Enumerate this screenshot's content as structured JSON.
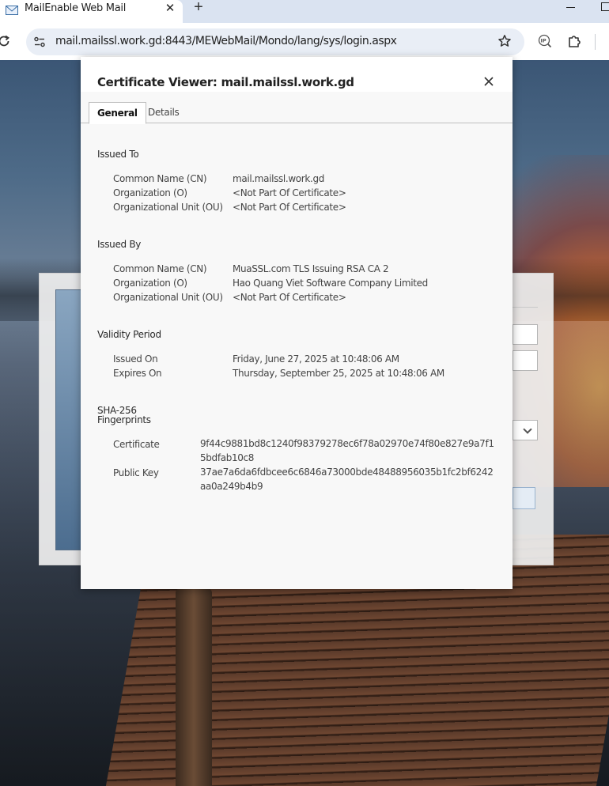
{
  "browser": {
    "tab_title": "MailEnable Web Mail",
    "tab_close": "✕",
    "new_tab": "+",
    "url": "mail.mailssl.work.gd:8443/MEWebMail/Mondo/lang/sys/login.aspx",
    "icons": [
      "envelope-favicon",
      "reload-icon",
      "site-info-icon",
      "star-icon",
      "ip-extension-icon",
      "extensions-puzzle-icon"
    ]
  },
  "dialog": {
    "title": "Certificate Viewer: mail.mailssl.work.gd",
    "close": "✕",
    "tabs": [
      {
        "label": "General",
        "active": true
      },
      {
        "label": "Details",
        "active": false
      }
    ],
    "issued_to": {
      "heading": "Issued To",
      "rows": [
        {
          "label": "Common Name (CN)",
          "value": "mail.mailssl.work.gd"
        },
        {
          "label": "Organization (O)",
          "value": "<Not Part Of Certificate>"
        },
        {
          "label": "Organizational Unit (OU)",
          "value": "<Not Part Of Certificate>"
        }
      ]
    },
    "issued_by": {
      "heading": "Issued By",
      "rows": [
        {
          "label": "Common Name (CN)",
          "value": "MuaSSL.com TLS Issuing RSA CA 2"
        },
        {
          "label": "Organization (O)",
          "value": "Hao Quang Viet Software Company Limited"
        },
        {
          "label": "Organizational Unit (OU)",
          "value": "<Not Part Of Certificate>"
        }
      ]
    },
    "validity": {
      "heading": "Validity Period",
      "rows": [
        {
          "label": "Issued On",
          "value": "Friday, June 27, 2025 at 10:48:06 AM"
        },
        {
          "label": "Expires On",
          "value": "Thursday, September 25, 2025 at 10:48:06 AM"
        }
      ]
    },
    "fingerprints": {
      "heading_line1": "SHA-256",
      "heading_line2": "Fingerprints",
      "rows": [
        {
          "label": "Certificate",
          "value": "9f44c9881bd8c1240f98379278ec6f78a02970e74f80e827e9a7f15bdfab10c8"
        },
        {
          "label": "Public Key",
          "value": "37ae7a6da6fdbcee6c6846a73000bde48488956035b1fc2bf6242aa0a249b4b9"
        }
      ]
    }
  }
}
